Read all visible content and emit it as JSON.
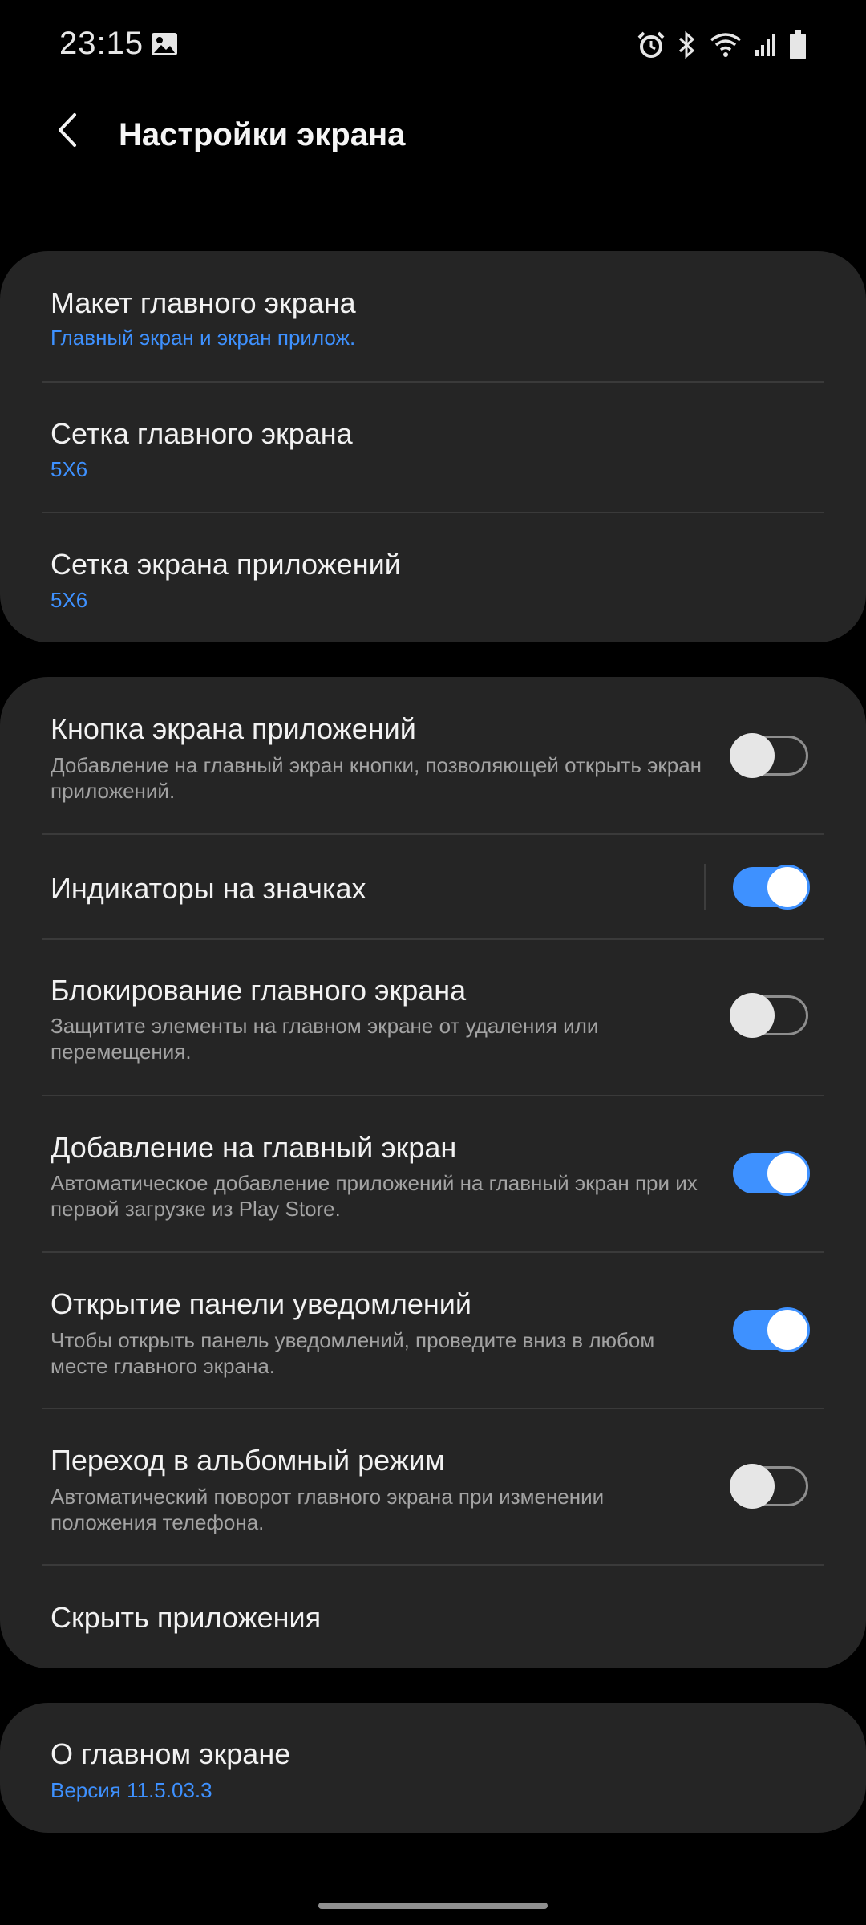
{
  "status_bar": {
    "time": "23:15",
    "icons": [
      "gallery-icon",
      "alarm-icon",
      "bluetooth-icon",
      "wifi-icon",
      "signal-icon",
      "battery-icon"
    ]
  },
  "header": {
    "title": "Настройки экрана",
    "back_icon": "back-arrow-icon"
  },
  "layout_group": {
    "items": [
      {
        "title": "Макет главного экрана",
        "value": "Главный экран и экран прилож."
      },
      {
        "title": "Сетка главного экрана",
        "value": "5X6"
      },
      {
        "title": "Сетка экрана приложений",
        "value": "5X6"
      }
    ]
  },
  "toggles_group": {
    "items": [
      {
        "title": "Кнопка экрана приложений",
        "description": "Добавление на главный экран кнопки, позволяющей открыть экран приложений.",
        "enabled": false
      },
      {
        "title": "Индикаторы на значках",
        "description": "",
        "enabled": true
      },
      {
        "title": "Блокирование главного экрана",
        "description": "Защитите элементы на главном экране от удаления или перемещения.",
        "enabled": false
      },
      {
        "title": "Добавление на главный экран",
        "description": "Автоматическое добавление приложений на главный экран при их первой загрузке из Play Store.",
        "enabled": true
      },
      {
        "title": "Открытие панели уведомлений",
        "description": "Чтобы открыть панель уведомлений, проведите вниз в любом месте главного экрана.",
        "enabled": true
      },
      {
        "title": "Переход в альбомный режим",
        "description": "Автоматический поворот главного экрана при изменении положения телефона.",
        "enabled": false
      }
    ],
    "hide_apps": "Скрыть приложения"
  },
  "about": {
    "title": "О главном экране",
    "version": "Версия 11.5.03.3"
  },
  "colors": {
    "background": "#000000",
    "card": "#252525",
    "accent": "#3e91ff",
    "secondary_text": "#a3a3a3"
  }
}
